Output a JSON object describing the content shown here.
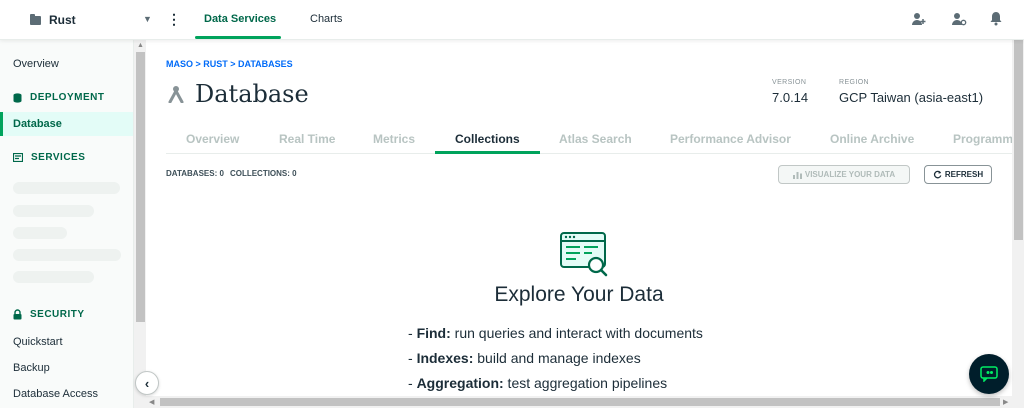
{
  "topbar": {
    "project": "Rust",
    "nav": [
      {
        "label": "Data Services",
        "active": true
      },
      {
        "label": "Charts",
        "active": false
      }
    ],
    "icons": [
      "invite-user-icon",
      "user-settings-icon",
      "notification-bell-icon"
    ]
  },
  "sidebar": {
    "overview": "Overview",
    "deployment_section": "DEPLOYMENT",
    "database": "Database",
    "services_section": "SERVICES",
    "security_section": "SECURITY",
    "quickstart": "Quickstart",
    "backup": "Backup",
    "database_access": "Database Access"
  },
  "header": {
    "breadcrumb": "MASO > RUST > DATABASES",
    "title": "Database",
    "version_label": "VERSION",
    "version": "7.0.14",
    "region_label": "REGION",
    "region": "GCP Taiwan (asia-east1)"
  },
  "tabs": [
    "Overview",
    "Real Time",
    "Metrics",
    "Collections",
    "Atlas Search",
    "Performance Advisor",
    "Online Archive",
    "Programm"
  ],
  "active_tab": "Collections",
  "toolbar": {
    "databases": "DATABASES: 0",
    "collections": "COLLECTIONS: 0",
    "visualize": "VISUALIZE YOUR DATA",
    "refresh": "REFRESH"
  },
  "explore": {
    "title": "Explore Your Data",
    "features": [
      {
        "prefix": "- ",
        "name": "Find:",
        "desc": " run queries and interact with documents"
      },
      {
        "prefix": "- ",
        "name": "Indexes:",
        "desc": " build and manage indexes"
      },
      {
        "prefix": "- ",
        "name": "Aggregation:",
        "desc": " test aggregation pipelines"
      }
    ]
  },
  "colors": {
    "accent_green": "#00a35c",
    "dark_green": "#00684a",
    "link_blue": "#016bf8",
    "dark_navy": "#001e2b"
  }
}
